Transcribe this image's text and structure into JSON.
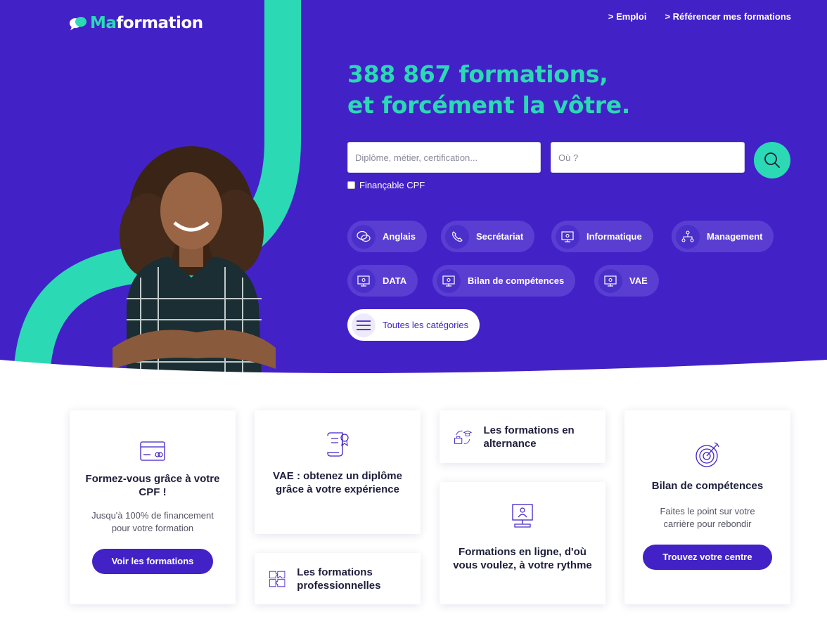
{
  "brand": {
    "logo_ma": "Ma",
    "logo_formation": "formation"
  },
  "nav": {
    "emploi": "> Emploi",
    "referencer": "> Référencer mes formations"
  },
  "hero": {
    "headline_line1": "388 867 formations,",
    "headline_line2": "et forcément la vôtre."
  },
  "search": {
    "what_placeholder": "Diplôme, métier, certification...",
    "where_placeholder": "Où ?",
    "cpf_label": "Finançable CPF"
  },
  "categories": [
    {
      "label": "Anglais",
      "icon": "chat-bubbles-icon"
    },
    {
      "label": "Secrétariat",
      "icon": "phone-icon"
    },
    {
      "label": "Informatique",
      "icon": "monitor-gear-icon"
    },
    {
      "label": "Management",
      "icon": "org-chart-icon"
    },
    {
      "label": "DATA",
      "icon": "monitor-gear-icon"
    },
    {
      "label": "Bilan de compétences",
      "icon": "monitor-gear-icon"
    },
    {
      "label": "VAE",
      "icon": "monitor-gear-icon"
    }
  ],
  "all_categories": "Toutes les catégories",
  "cards": {
    "cpf": {
      "title": "Formez-vous grâce à votre CPF !",
      "sub": "Jusqu'à 100% de financement pour votre formation",
      "button": "Voir les formations"
    },
    "vae": {
      "title": "VAE : obtenez un diplôme grâce à votre expérience"
    },
    "pro": {
      "title": "Les formations professionnelles"
    },
    "alternance": {
      "title": "Les formations en alternance"
    },
    "online": {
      "title": "Formations en ligne, d'où vous voulez, à votre rythme"
    },
    "bilan": {
      "title": "Bilan de compétences",
      "sub": "Faites le point sur votre carrière pour rebondir",
      "button": "Trouvez votre centre"
    }
  },
  "colors": {
    "primary": "#4222c6",
    "accent": "#2bd9b5"
  }
}
